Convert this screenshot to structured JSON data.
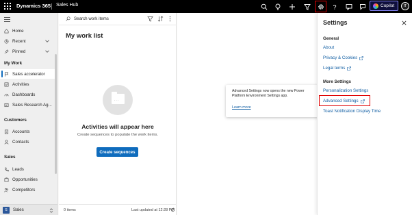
{
  "topbar": {
    "app_name": "Dynamics 365",
    "hub_name": "Sales Hub",
    "copilot_label": "Copilot",
    "avatar_initials": "IT",
    "icons": [
      "search-icon",
      "lightbulb-icon",
      "plus-icon",
      "filter-icon",
      "gear-icon",
      "help-icon",
      "chat-icon",
      "feedback-icon"
    ]
  },
  "sidebar": {
    "top_items": [
      {
        "label": "Home",
        "icon": "home-icon"
      },
      {
        "label": "Recent",
        "icon": "clock-icon"
      },
      {
        "label": "Pinned",
        "icon": "pin-icon"
      }
    ],
    "sections": [
      {
        "title": "My Work",
        "items": [
          {
            "label": "Sales accelerator",
            "icon": "flag-icon",
            "active": true
          },
          {
            "label": "Activities",
            "icon": "checklist-icon"
          },
          {
            "label": "Dashboards",
            "icon": "dashboard-icon"
          },
          {
            "label": "Sales Research Ag...",
            "icon": "research-icon"
          }
        ]
      },
      {
        "title": "Customers",
        "items": [
          {
            "label": "Accounts",
            "icon": "building-icon"
          },
          {
            "label": "Contacts",
            "icon": "person-icon"
          }
        ]
      },
      {
        "title": "Sales",
        "items": [
          {
            "label": "Leads",
            "icon": "phone-icon"
          },
          {
            "label": "Opportunities",
            "icon": "opportunity-icon"
          },
          {
            "label": "Competitors",
            "icon": "competitor-icon"
          }
        ]
      }
    ],
    "area": {
      "badge": "S",
      "label": "Sales"
    }
  },
  "worklist": {
    "search_placeholder": "Search work items",
    "title": "My work list",
    "empty_title": "Activities will appear here",
    "empty_subtitle": "Create sequences to populate the work items.",
    "create_button": "Create sequences",
    "footer_count": "0 items",
    "footer_updated": "Last updated at 12:28 PM"
  },
  "popup": {
    "text": "Advanced Settings now opens the new Power Platform Environment Settings app.",
    "link": "Learn more"
  },
  "settings": {
    "title": "Settings",
    "general_title": "General",
    "about": "About",
    "privacy": "Privacy & Cookies",
    "legal": "Legal terms",
    "more_title": "More Settings",
    "personalization": "Personalization Settings",
    "advanced": "Advanced Settings",
    "toast": "Toast Notification Display Time"
  },
  "colors": {
    "accent": "#0f6cbd",
    "highlight_border": "#e00000",
    "topbar": "#000000"
  }
}
